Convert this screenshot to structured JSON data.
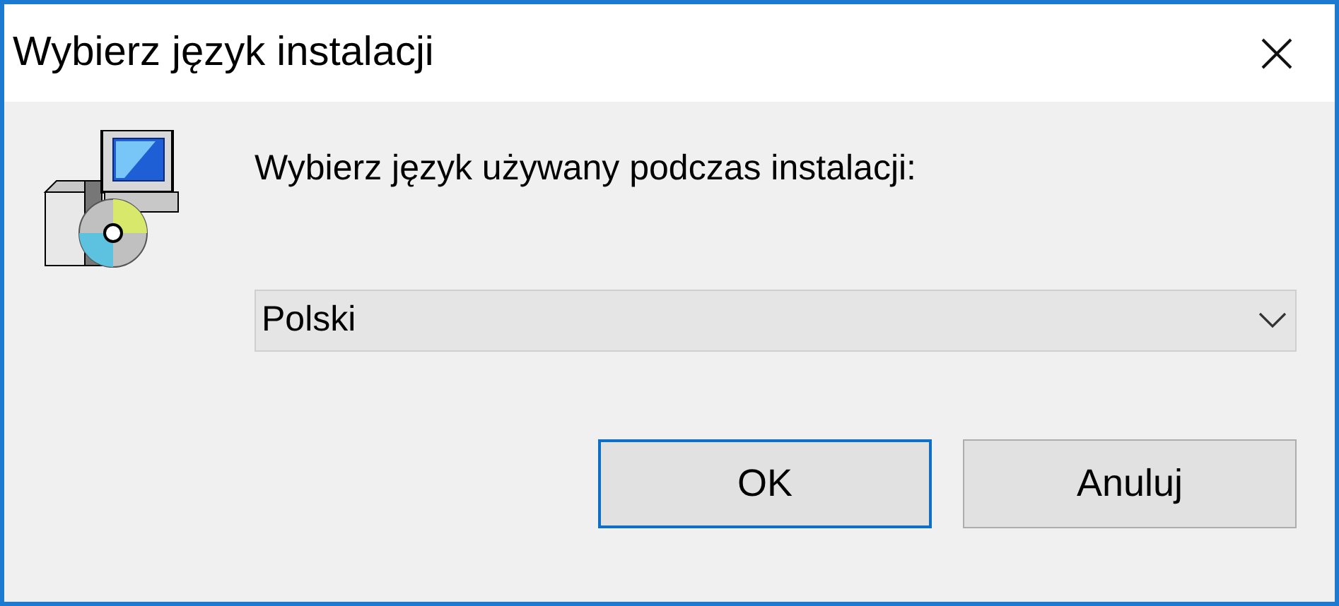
{
  "window": {
    "title": "Wybierz język instalacji"
  },
  "prompt": "Wybierz język używany podczas instalacji:",
  "language_select": {
    "value": "Polski"
  },
  "buttons": [
    {
      "label": "OK",
      "default": true
    },
    {
      "label": "Anuluj",
      "default": false
    }
  ]
}
